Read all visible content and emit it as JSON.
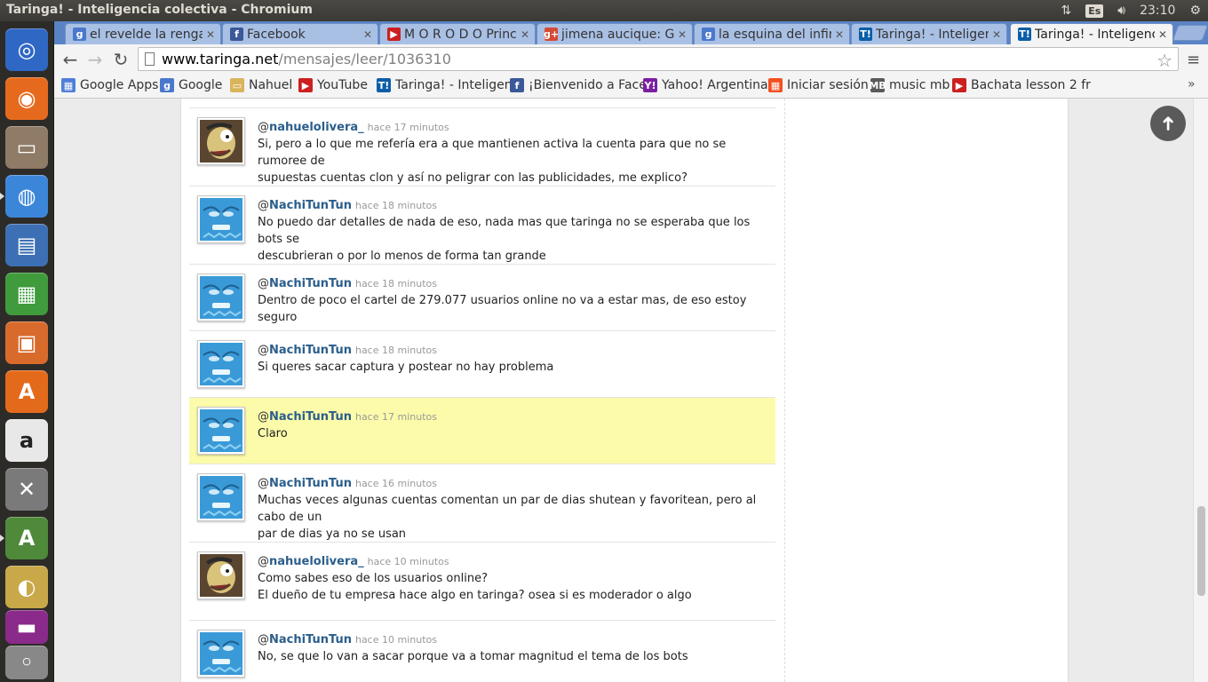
{
  "window": {
    "title": "Taringa! - Inteligencia colectiva - Chromium"
  },
  "panel": {
    "keyboard": "Es",
    "time": "23:10"
  },
  "launcher": {
    "items": [
      {
        "name": "ubuntu-dash-icon",
        "color": "#2f67c4",
        "glyph": "◎"
      },
      {
        "name": "firefox-icon",
        "color": "#e66a1e",
        "glyph": "◉"
      },
      {
        "name": "files-icon",
        "color": "#8f7b66",
        "glyph": "▭"
      },
      {
        "name": "chromium-icon",
        "color": "#3c86d9",
        "glyph": "◍"
      },
      {
        "name": "writer-icon",
        "color": "#3d6fb4",
        "glyph": "▤"
      },
      {
        "name": "calc-icon",
        "color": "#3f9b3c",
        "glyph": "▦"
      },
      {
        "name": "impress-icon",
        "color": "#d86b2c",
        "glyph": "▣"
      },
      {
        "name": "software-center-icon",
        "color": "#e46a1b",
        "glyph": "A"
      },
      {
        "name": "amazon-icon",
        "color": "#e8e8e8",
        "glyph": "a"
      },
      {
        "name": "system-settings-icon",
        "color": "#7a7a7a",
        "glyph": "✕"
      },
      {
        "name": "update-manager-icon",
        "color": "#4f8a3a",
        "glyph": "A"
      },
      {
        "name": "image-viewer-icon",
        "color": "#c8a848",
        "glyph": "◐"
      },
      {
        "name": "workspace-switcher-icon",
        "color": "#8a2a8a",
        "glyph": "▬"
      },
      {
        "name": "dvd-icon",
        "color": "#888888",
        "glyph": "◦"
      }
    ]
  },
  "tabs": [
    {
      "label": "el revelde la renga c",
      "favicon": "g",
      "fav_color": "#4a78cc"
    },
    {
      "label": "Facebook",
      "favicon": "f",
      "fav_color": "#3b5998"
    },
    {
      "label": "M O R O D O Prince",
      "favicon": "▶",
      "fav_color": "#cc1f1f"
    },
    {
      "label": "jimena aucique: Goo",
      "favicon": "g+",
      "fav_color": "#d44a36"
    },
    {
      "label": "la esquina del infinit",
      "favicon": "g",
      "fav_color": "#4a78cc"
    },
    {
      "label": "Taringa! - Inteligenc",
      "favicon": "T!",
      "fav_color": "#0b5ea8"
    },
    {
      "label": "Taringa! - Inteligenc",
      "favicon": "T!",
      "fav_color": "#0b5ea8"
    }
  ],
  "address": {
    "host": "www.taringa.net",
    "path": "/mensajes/leer/1036310"
  },
  "bookmarks": [
    {
      "label": "Google Apps",
      "icon": "▦",
      "color": "#4f7fd8"
    },
    {
      "label": "Google",
      "icon": "g",
      "color": "#4a78cc"
    },
    {
      "label": "Nahuel",
      "icon": "▭",
      "color": "#d9b45a"
    },
    {
      "label": "YouTube",
      "icon": "▶",
      "color": "#cc1f1f"
    },
    {
      "label": "Taringa! - Inteligen",
      "icon": "T!",
      "color": "#0b5ea8"
    },
    {
      "label": "¡Bienvenido a Face",
      "icon": "f",
      "color": "#3b5998"
    },
    {
      "label": "Yahoo! Argentina",
      "icon": "Y!",
      "color": "#7b1fa2"
    },
    {
      "label": "Iniciar sesión",
      "icon": "▦",
      "color": "#f25022"
    },
    {
      "label": "music mb",
      "icon": "MB",
      "color": "#5a5a5a"
    },
    {
      "label": "Bachata lesson 2 fr",
      "icon": "▶",
      "color": "#cc1f1f"
    }
  ],
  "messages": [
    {
      "user": "nahuelolivera_",
      "time": "hace 17 minutos",
      "avatar": "brown",
      "highlight": false,
      "lines": [
        "Si, pero a lo que me refería era a que mantienen activa la cuenta para que no se rumoree de",
        "supuestas cuentas clon y así no peligrar con las publicidades, me explico?"
      ]
    },
    {
      "user": "NachiTunTun",
      "time": "hace 18 minutos",
      "avatar": "blue",
      "highlight": false,
      "lines": [
        "No puedo dar detalles de nada de eso, nada mas que taringa no se esperaba que los bots se",
        "descubrieran o por lo menos de forma tan grande"
      ]
    },
    {
      "user": "NachiTunTun",
      "time": "hace 18 minutos",
      "avatar": "blue",
      "highlight": false,
      "lines": [
        "Dentro de poco el cartel de 279.077 usuarios online no va a estar mas, de eso estoy seguro"
      ]
    },
    {
      "user": "NachiTunTun",
      "time": "hace 18 minutos",
      "avatar": "blue",
      "highlight": false,
      "lines": [
        "Si queres sacar captura y postear no hay problema"
      ]
    },
    {
      "user": "NachiTunTun",
      "time": "hace 17 minutos",
      "avatar": "blue",
      "highlight": true,
      "lines": [
        "Claro"
      ]
    },
    {
      "user": "NachiTunTun",
      "time": "hace 16 minutos",
      "avatar": "blue",
      "highlight": false,
      "lines": [
        "Muchas veces algunas cuentas comentan un par de dias shutean y favoritean, pero al cabo de un",
        "par de dias ya no se usan"
      ]
    },
    {
      "user": "nahuelolivera_",
      "time": "hace 10 minutos",
      "avatar": "brown",
      "highlight": false,
      "lines": [
        "Como sabes eso de los usuarios online?",
        "El dueño de tu empresa hace algo en taringa? osea si es moderador o algo"
      ]
    },
    {
      "user": "NachiTunTun",
      "time": "hace 10 minutos",
      "avatar": "blue",
      "highlight": false,
      "lines": [
        "No, se que lo van a sacar porque va a tomar magnitud el tema de los bots"
      ]
    }
  ]
}
